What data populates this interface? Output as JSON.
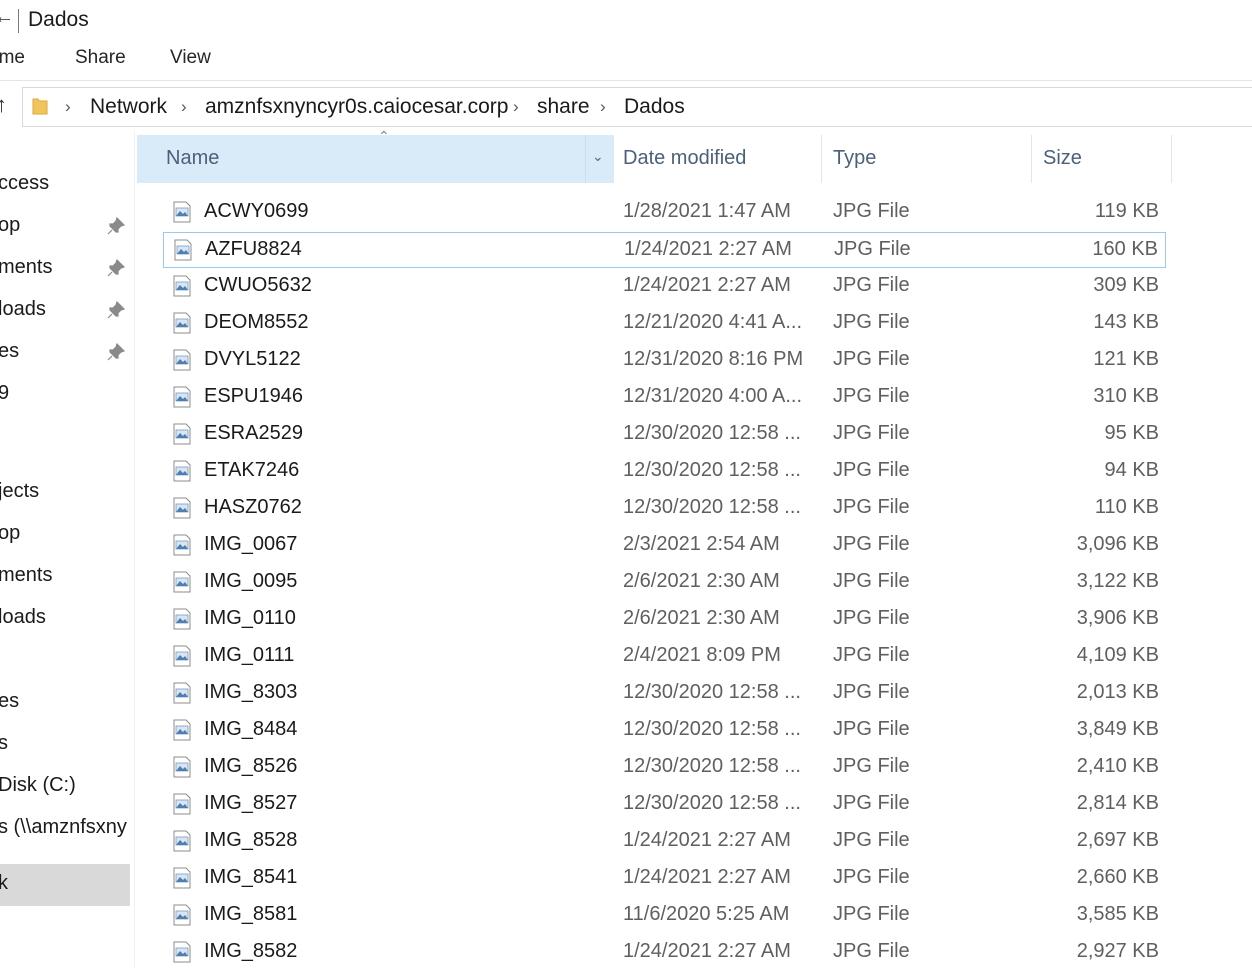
{
  "window": {
    "title": "Dados"
  },
  "ribbon": {
    "tabs": [
      "ome",
      "Share",
      "View"
    ]
  },
  "address": {
    "crumbs": [
      "Network",
      "amznfsxnyncyr0s.caiocesar.corp",
      "share",
      "Dados"
    ]
  },
  "nav": {
    "items": [
      {
        "label": "ccess",
        "pinned": false
      },
      {
        "label": "op",
        "pinned": true
      },
      {
        "label": "ments",
        "pinned": true
      },
      {
        "label": "loads",
        "pinned": true
      },
      {
        "label": "es",
        "pinned": true
      },
      {
        "label": "9",
        "pinned": false
      },
      {
        "label": "",
        "pinned": false
      },
      {
        "label": "jects",
        "pinned": false
      },
      {
        "label": "op",
        "pinned": false
      },
      {
        "label": "ments",
        "pinned": false
      },
      {
        "label": "loads",
        "pinned": false
      },
      {
        "label": "",
        "pinned": false
      },
      {
        "label": "es",
        "pinned": false
      },
      {
        "label": "s",
        "pinned": false
      },
      {
        "label": "Disk (C:)",
        "pinned": false
      },
      {
        "label": "s (\\\\amznfsxny",
        "pinned": false
      },
      {
        "label": "k",
        "pinned": false,
        "selected": true
      }
    ]
  },
  "columns": {
    "name": "Name",
    "date": "Date modified",
    "type": "Type",
    "size": "Size"
  },
  "files": [
    {
      "name": "ACWY0699",
      "date": "1/28/2021 1:47 AM",
      "type": "JPG File",
      "size": "119 KB"
    },
    {
      "name": "AZFU8824",
      "date": "1/24/2021 2:27 AM",
      "type": "JPG File",
      "size": "160 KB",
      "focused": true
    },
    {
      "name": "CWUO5632",
      "date": "1/24/2021 2:27 AM",
      "type": "JPG File",
      "size": "309 KB"
    },
    {
      "name": "DEOM8552",
      "date": "12/21/2020 4:41 A...",
      "type": "JPG File",
      "size": "143 KB"
    },
    {
      "name": "DVYL5122",
      "date": "12/31/2020 8:16 PM",
      "type": "JPG File",
      "size": "121 KB"
    },
    {
      "name": "ESPU1946",
      "date": "12/31/2020 4:00 A...",
      "type": "JPG File",
      "size": "310 KB"
    },
    {
      "name": "ESRA2529",
      "date": "12/30/2020 12:58 ...",
      "type": "JPG File",
      "size": "95 KB"
    },
    {
      "name": "ETAK7246",
      "date": "12/30/2020 12:58 ...",
      "type": "JPG File",
      "size": "94 KB"
    },
    {
      "name": "HASZ0762",
      "date": "12/30/2020 12:58 ...",
      "type": "JPG File",
      "size": "110 KB"
    },
    {
      "name": "IMG_0067",
      "date": "2/3/2021 2:54 AM",
      "type": "JPG File",
      "size": "3,096 KB"
    },
    {
      "name": "IMG_0095",
      "date": "2/6/2021 2:30 AM",
      "type": "JPG File",
      "size": "3,122 KB"
    },
    {
      "name": "IMG_0110",
      "date": "2/6/2021 2:30 AM",
      "type": "JPG File",
      "size": "3,906 KB"
    },
    {
      "name": "IMG_0111",
      "date": "2/4/2021 8:09 PM",
      "type": "JPG File",
      "size": "4,109 KB"
    },
    {
      "name": "IMG_8303",
      "date": "12/30/2020 12:58 ...",
      "type": "JPG File",
      "size": "2,013 KB"
    },
    {
      "name": "IMG_8484",
      "date": "12/30/2020 12:58 ...",
      "type": "JPG File",
      "size": "3,849 KB"
    },
    {
      "name": "IMG_8526",
      "date": "12/30/2020 12:58 ...",
      "type": "JPG File",
      "size": "2,410 KB"
    },
    {
      "name": "IMG_8527",
      "date": "12/30/2020 12:58 ...",
      "type": "JPG File",
      "size": "2,814 KB"
    },
    {
      "name": "IMG_8528",
      "date": "1/24/2021 2:27 AM",
      "type": "JPG File",
      "size": "2,697 KB"
    },
    {
      "name": "IMG_8541",
      "date": "1/24/2021 2:27 AM",
      "type": "JPG File",
      "size": "2,660 KB"
    },
    {
      "name": "IMG_8581",
      "date": "11/6/2020 5:25 AM",
      "type": "JPG File",
      "size": "3,585 KB"
    },
    {
      "name": "IMG_8582",
      "date": "1/24/2021 2:27 AM",
      "type": "JPG File",
      "size": "2,927 KB"
    }
  ],
  "icons": {
    "file": "image-file-icon",
    "folder": "folder-icon",
    "pin": "pin-icon",
    "up": "up-arrow-icon",
    "breadcrumb_separator": "chevron-right-icon",
    "sort": "sort-ascending-icon",
    "dropdown": "chevron-down-icon"
  },
  "colors": {
    "header_highlight": "#d9ebf9",
    "focus_border": "#99c9ef",
    "nav_selected": "#d9d9d9",
    "folder": "#f2c55c"
  }
}
